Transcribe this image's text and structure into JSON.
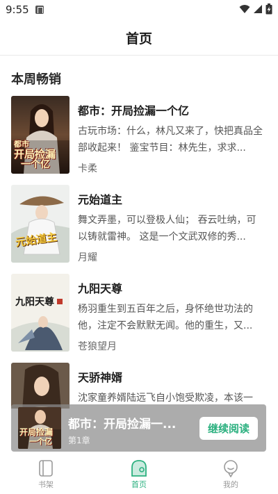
{
  "status_bar": {
    "time": "9:55",
    "icons": [
      "notification-a-icon",
      "wifi-icon",
      "signal-icon",
      "battery-charging-icon"
    ]
  },
  "header": {
    "title": "首页"
  },
  "section": {
    "title": "本周畅销"
  },
  "books": [
    {
      "title": "都市：开局捡漏一个亿",
      "description": "古玩市场：什么，林凡又来了，快把真品全部收起来！ 鉴宝节目：林先生，求求...",
      "author": "卡柔",
      "cover_text_line1": "都市",
      "cover_text_line2": "开局捡漏",
      "cover_text_line3": "一个亿"
    },
    {
      "title": "元始道主",
      "description": "舞文弄墨，可以登极人仙； 吞云吐纳，可以铸就雷神。 这是一个文武双修的秀...",
      "author": "月耀",
      "cover_text_line1": "元始道主"
    },
    {
      "title": "九阳天尊",
      "description": "杨羽重生到五百年之后，身怀绝世功法的他，注定不会默默无闻。他的重生，又...",
      "author": "苍狼望月",
      "cover_text_line1": "九阳天尊"
    },
    {
      "title": "天骄神婿",
      "description": "沈家童养婿陆远飞自小饱受欺凌，本该一",
      "author": "",
      "cover_text_line1": ""
    }
  ],
  "continue_reading": {
    "title": "都市：开局捡漏一...",
    "chapter": "第1章",
    "button_label": "继续阅读"
  },
  "bottom_nav": {
    "items": [
      {
        "label": "书架",
        "icon": "bookshelf-icon",
        "active": false
      },
      {
        "label": "首页",
        "icon": "home-icon",
        "active": true
      },
      {
        "label": "我的",
        "icon": "profile-icon",
        "active": false
      }
    ]
  },
  "colors": {
    "accent": "#2bb07f",
    "nav_inactive": "#999999",
    "text_primary": "#1a1a1a",
    "text_secondary": "#555555"
  }
}
